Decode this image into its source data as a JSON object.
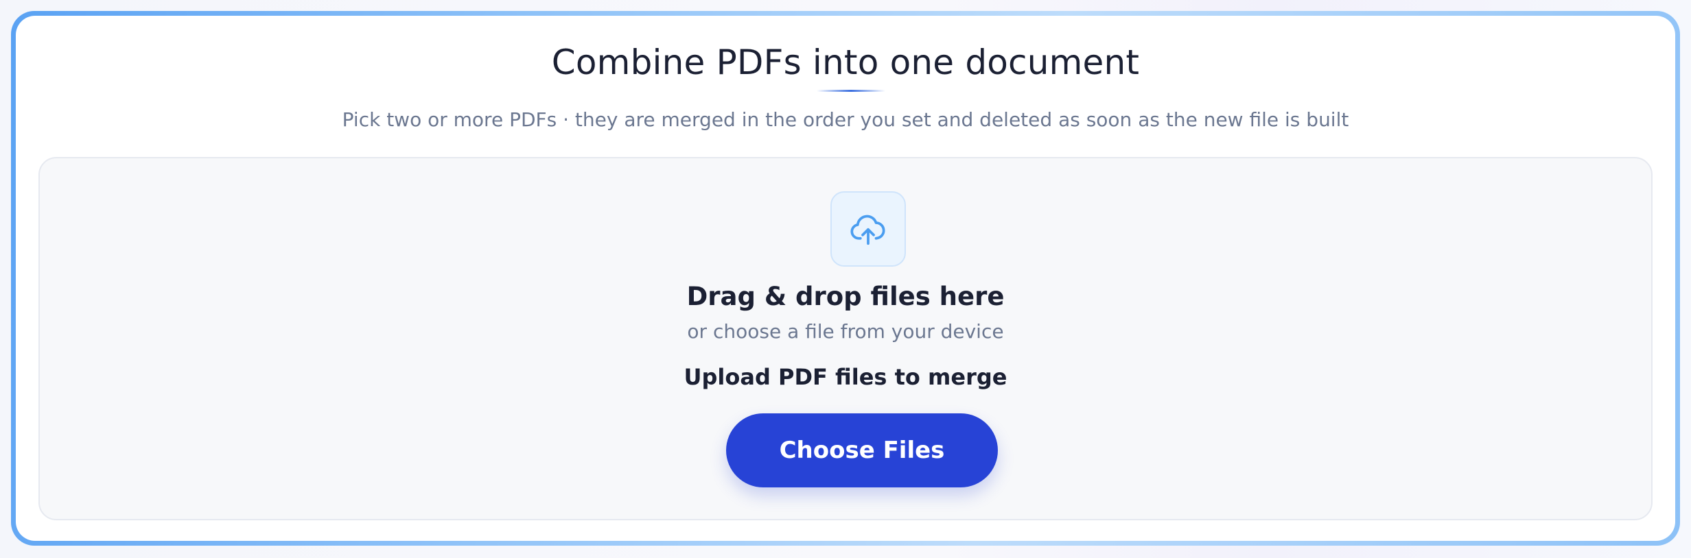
{
  "header": {
    "title": "Combine PDFs into one document",
    "subtitle": "Pick two or more PDFs · they are merged in the order you set and deleted as soon as the new file is built"
  },
  "dropzone": {
    "icon": "cloud-upload-icon",
    "title": "Drag & drop files here",
    "subtitle": "or choose a file from your device",
    "label": "Upload PDF files to merge",
    "button_label": "Choose Files"
  },
  "colors": {
    "accent": "#2743d6",
    "icon": "#4a9df0",
    "frame": "#8ec2f8"
  }
}
